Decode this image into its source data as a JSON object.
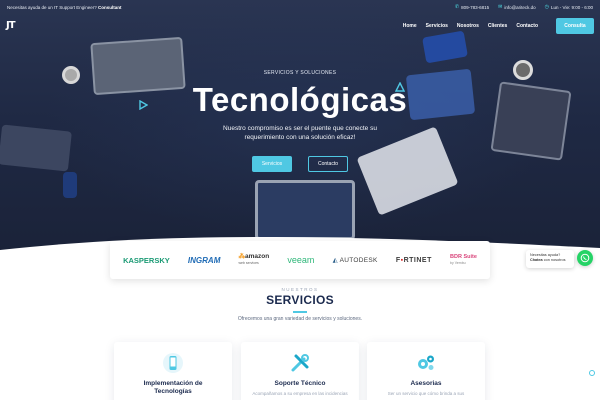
{
  "topbar": {
    "promo_text": "Necesitas ayuda de un IT Support Engineer?",
    "promo_link": "Consultant",
    "phone": "809-783-6815",
    "email": "info@ariteck.do",
    "hours": "Lun - Vie: 9:00 - 6:00"
  },
  "nav": {
    "logo_text": "JT",
    "items": [
      "Home",
      "Servicios",
      "Nosotros",
      "Clientes",
      "Contacto"
    ],
    "cta": "Consulta"
  },
  "hero": {
    "eyebrow": "SERVICIOS Y SOLUCIONES",
    "title": "Tecnológicas",
    "subtitle_line1": "Nuestro compromiso es ser el puente que conecte su",
    "subtitle_line2": "requerimiento con una solución eficaz!",
    "btn_primary": "Servicios",
    "btn_secondary": "Contacto"
  },
  "partners": {
    "kaspersky": "KASPERSKY",
    "ingram": "INGRAM",
    "amazon": "amazon",
    "amazon_sub": "web services",
    "veeam": "veeam",
    "autodesk": "AUTODESK",
    "fortinet_a": "F",
    "fortinet_b": "RTINET",
    "bdr": "BDR Suite",
    "bdr_sub": "by Vembu"
  },
  "services": {
    "eyebrow": "NUESTROS",
    "title": "SERVICIOS",
    "description": "Ofrecemos una gran variedad de servicios y soluciones.",
    "cards": [
      {
        "title_line1": "Implementación de",
        "title_line2": "Tecnologías",
        "icon": "mobile-icon"
      },
      {
        "title_line1": "Soporte Técnico",
        "title_line2": "",
        "text": "Acompañamos a su empresa en las incidencias",
        "icon": "tools-icon"
      },
      {
        "title_line1": "Asesorias",
        "title_line2": "",
        "text": "Ser un servicio que cómo brinda a sus",
        "icon": "gears-icon"
      }
    ]
  },
  "whatsapp": {
    "bubble_text": "Necesitas ayuda?",
    "bubble_bold": "Chatea",
    "bubble_rest": "con nosotros"
  },
  "colors": {
    "accent": "#4fc8e3",
    "navy": "#1b2a4e",
    "whatsapp": "#25d366"
  }
}
